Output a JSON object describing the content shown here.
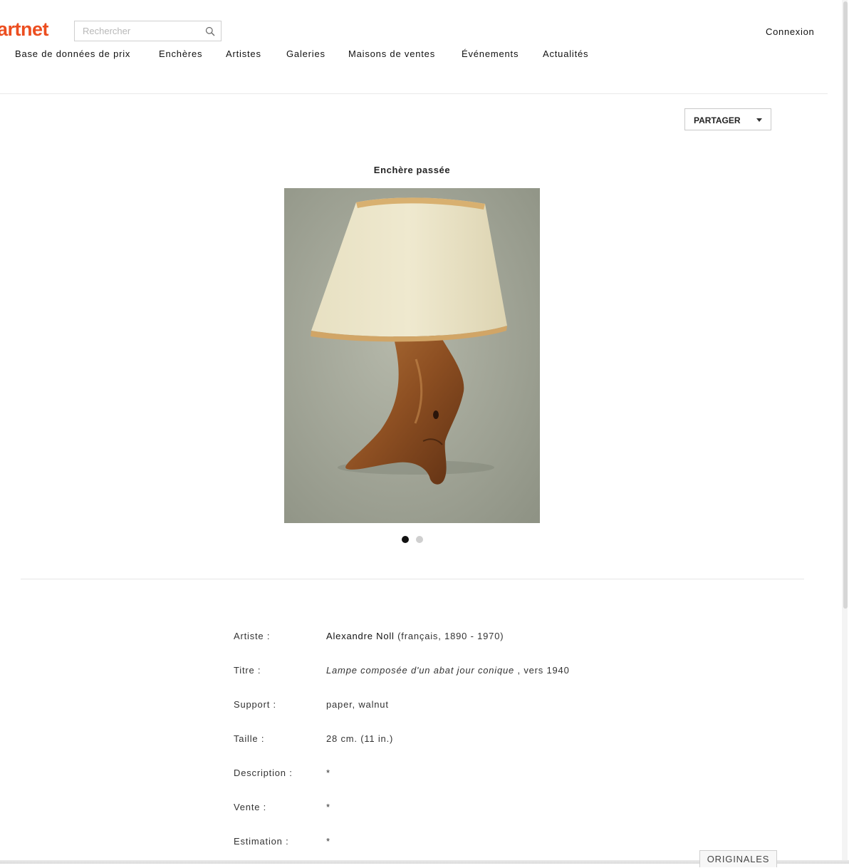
{
  "logo": "artnet",
  "search": {
    "placeholder": "Rechercher"
  },
  "header": {
    "login": "Connexion"
  },
  "nav": [
    "Base de données de prix",
    "Enchères",
    "Artistes",
    "Galeries",
    "Maisons de ventes",
    "Événements",
    "Actualités"
  ],
  "share": {
    "label": "PARTAGER"
  },
  "lot": {
    "status": "Enchère passée",
    "image_count": 2,
    "active_image": 1,
    "details": [
      {
        "key": "Artiste :",
        "artist_name": "Alexandre Noll",
        "artist_info": " (français, 1890 - 1970)"
      },
      {
        "key": "Titre :",
        "title_italic": "Lampe composée d'un abat jour conique",
        "title_rest": " , vers 1940"
      },
      {
        "key": "Support :",
        "value": "paper, walnut"
      },
      {
        "key": "Taille :",
        "value": "28 cm. (11 in.)"
      },
      {
        "key": "Description :",
        "value": "*"
      },
      {
        "key": "Vente :",
        "value": "*"
      },
      {
        "key": "Estimation :",
        "value": "*"
      }
    ]
  },
  "footer_tab": "ORIGINALES",
  "colors": {
    "brand": "#ec4e20",
    "text": "#222222",
    "active_dot": "#111111",
    "inactive_dot": "#cfcfcf"
  },
  "icons": {
    "search": "search-icon",
    "share_caret": "caret-down-icon"
  }
}
